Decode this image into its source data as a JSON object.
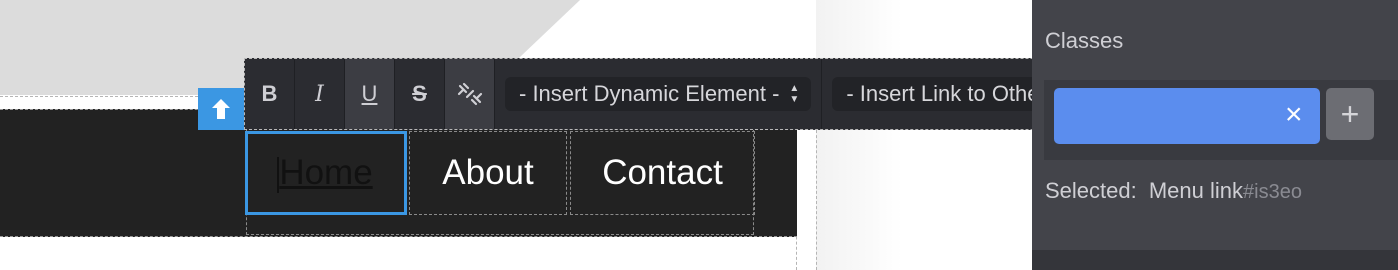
{
  "nav": {
    "links": [
      "Home",
      "About",
      "Contact"
    ]
  },
  "toolbar": {
    "bold": "B",
    "italic": "I",
    "underline": "U",
    "strike": "S",
    "dynamic_select": "- Insert Dynamic Element -",
    "link_select": "- Insert Link to Other Event Page -"
  },
  "panel": {
    "classes_label": "Classes",
    "tag_close": "×",
    "add_label": "+",
    "selected_label": "Selected:",
    "selected_value": "Menu link",
    "selected_id": "#is3eo"
  },
  "colors": {
    "accent": "#3b97e3",
    "tag": "#5b8dee",
    "panel_bg": "#43444a",
    "toolbar_bg": "#2b2c31",
    "navbar_bg": "#222222"
  },
  "icons": [
    "arrow-up-icon",
    "unlink-icon",
    "updown-arrows-icon"
  ]
}
